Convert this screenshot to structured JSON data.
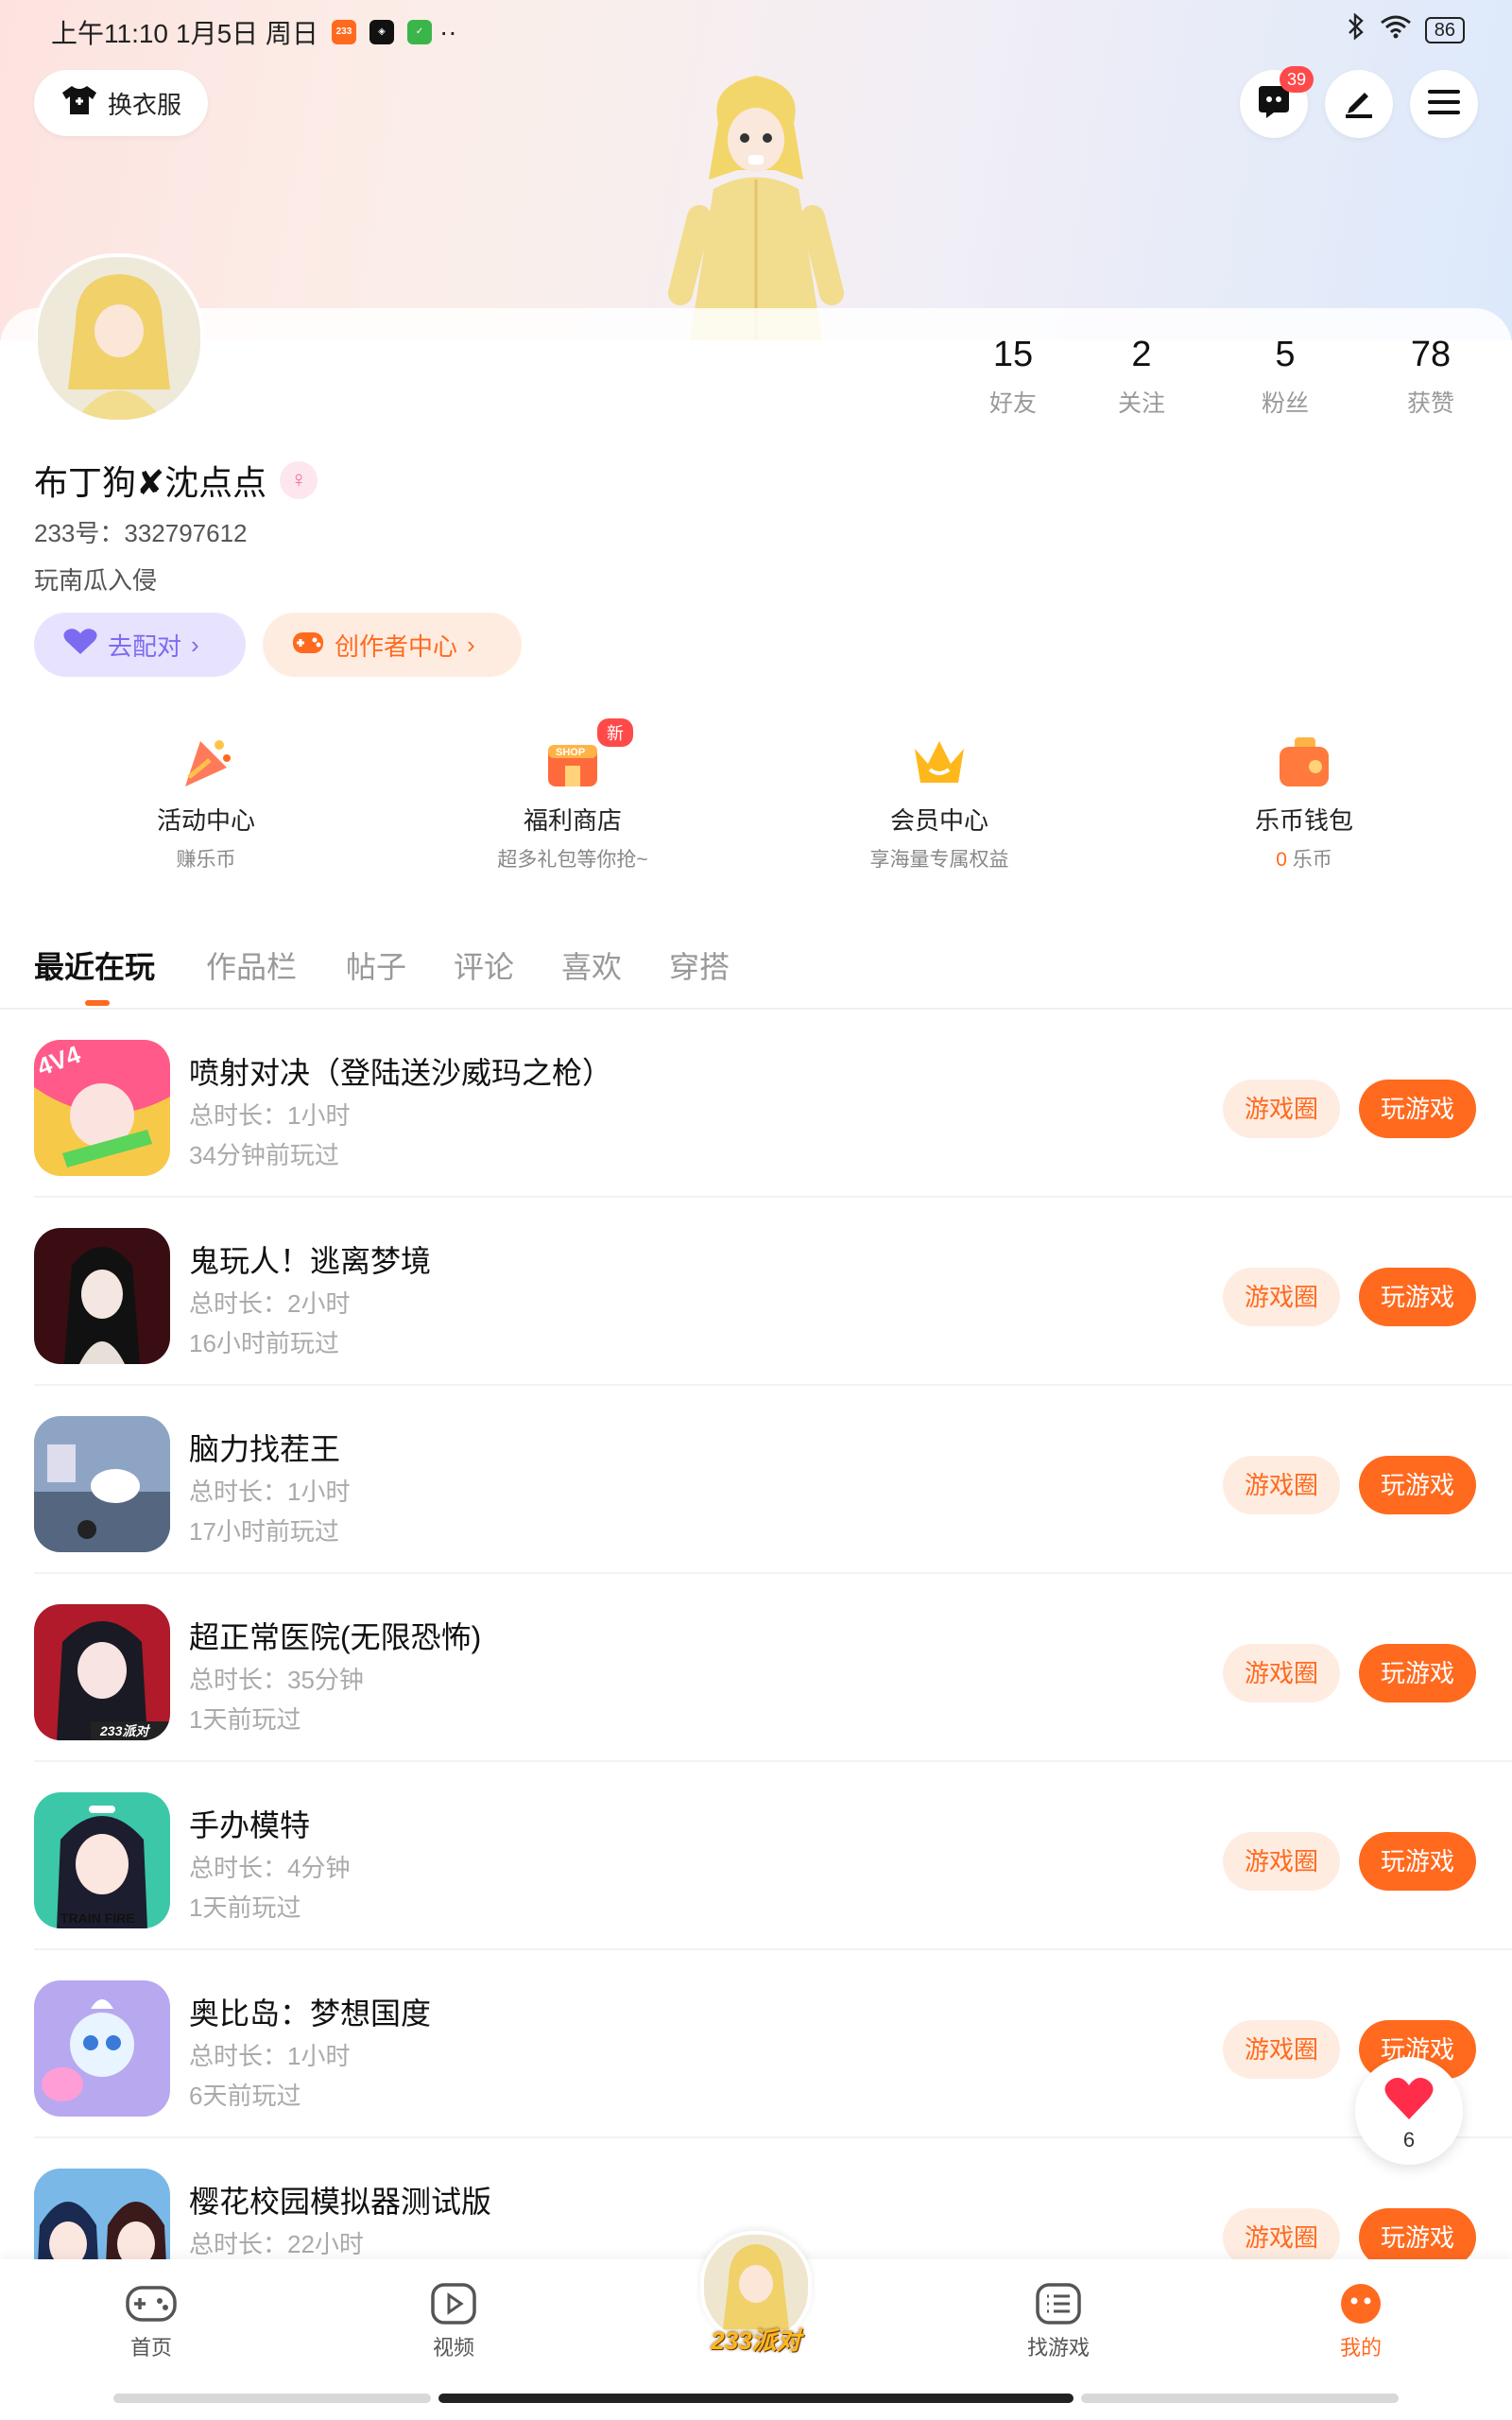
{
  "status_bar": {
    "time": "上午11:10",
    "date": "1月5日 周日",
    "dots": "··",
    "battery": "86"
  },
  "header": {
    "change_outfit_label": "换衣服",
    "message_badge": "39"
  },
  "profile": {
    "stats": [
      {
        "value": "15",
        "label": "好友"
      },
      {
        "value": "2",
        "label": "关注"
      },
      {
        "value": "5",
        "label": "粉丝"
      },
      {
        "value": "78",
        "label": "获赞"
      }
    ],
    "name": "布丁狗✘沈点点",
    "gender_symbol": "♀",
    "uid": "233号：332797612",
    "signature": "玩南瓜入侵",
    "tag_pair": "去配对",
    "tag_creator": "创作者中心"
  },
  "services": [
    {
      "title": "活动中心",
      "sub": "赚乐币"
    },
    {
      "title": "福利商店",
      "sub": "超多礼包等你抢~",
      "badge": "新"
    },
    {
      "title": "会员中心",
      "sub": "享海量专属权益"
    },
    {
      "title": "乐币钱包",
      "sub_num": "0",
      "sub": "乐币"
    }
  ],
  "tabs": [
    "最近在玩",
    "作品栏",
    "帖子",
    "评论",
    "喜欢",
    "穿搭"
  ],
  "games": [
    {
      "title": "喷射对决（登陆送沙威玛之枪）",
      "duration": "总时长：1小时",
      "last": "34分钟前玩过"
    },
    {
      "title": "鬼玩人！逃离梦境",
      "duration": "总时长：2小时",
      "last": "16小时前玩过"
    },
    {
      "title": "脑力找茬王",
      "duration": "总时长：1小时",
      "last": "17小时前玩过"
    },
    {
      "title": "超正常医院(无限恐怖)",
      "duration": "总时长：35分钟",
      "last": "1天前玩过"
    },
    {
      "title": "手办模特",
      "duration": "总时长：4分钟",
      "last": "1天前玩过"
    },
    {
      "title": "奥比岛：梦想国度",
      "duration": "总时长：1小时",
      "last": "6天前玩过"
    },
    {
      "title": "樱花校园模拟器测试版",
      "duration": "总时长：22小时",
      "last": ""
    }
  ],
  "buttons": {
    "circle": "游戏圈",
    "play": "玩游戏"
  },
  "thumb_text": {
    "g1": "4V4",
    "g4": "233派对",
    "g5": "TRAIN FIRE"
  },
  "float_heart_count": "6",
  "bottom_nav": {
    "home": "首页",
    "video": "视频",
    "center": "233派对",
    "find": "找游戏",
    "mine": "我的"
  },
  "colors": {
    "accent": "#ff6a1f",
    "accent_light": "#ffece0",
    "purple": "#7c6bf0"
  }
}
